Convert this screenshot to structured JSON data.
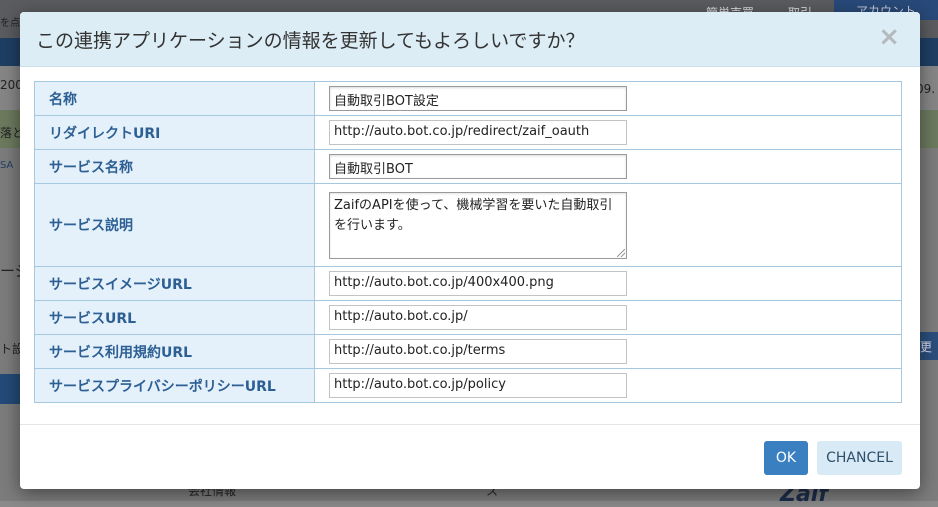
{
  "background": {
    "nav_items": [
      "簡単売買",
      "取引"
    ],
    "account_label": "アカウント",
    "left_fragments": [
      "を点",
      "200",
      "落と",
      "SA",
      "ージ",
      "ト設",
      "ー"
    ],
    "right_fragments": [
      "09.",
      "変更"
    ],
    "bottom_fragments": [
      "会社情報",
      "ス"
    ],
    "brand": "Zaif"
  },
  "modal": {
    "title": "この連携アプリケーションの情報を更新してもよろしいですか？",
    "close_symbol": "×",
    "rows": [
      {
        "label": "名称",
        "value": "自動取引BOT設定"
      },
      {
        "label": "リダイレクトURI",
        "value": "http://auto.bot.co.jp/redirect/zaif_oauth"
      },
      {
        "label": "サービス名称",
        "value": "自動取引BOT"
      },
      {
        "label": "サービス説明",
        "value": "ZaifのAPIを使って、機械学習を要いた自動取引を行います。"
      },
      {
        "label": "サービスイメージURL",
        "value": "http://auto.bot.co.jp/400x400.png"
      },
      {
        "label": "サービスURL",
        "value": "http://auto.bot.co.jp/"
      },
      {
        "label": "サービス利用規約URL",
        "value": "http://auto.bot.co.jp/terms"
      },
      {
        "label": "サービスプライバシーポリシーURL",
        "value": "http://auto.bot.co.jp/policy"
      }
    ],
    "ok_label": "OK",
    "cancel_label": "CHANCEL"
  },
  "colors": {
    "header_bg": "#dcedf6",
    "label_bg": "#e4f0fa",
    "label_text": "#2c5f93",
    "ok_bg": "#3a7fc0",
    "cancel_bg": "#d8eaf6"
  }
}
